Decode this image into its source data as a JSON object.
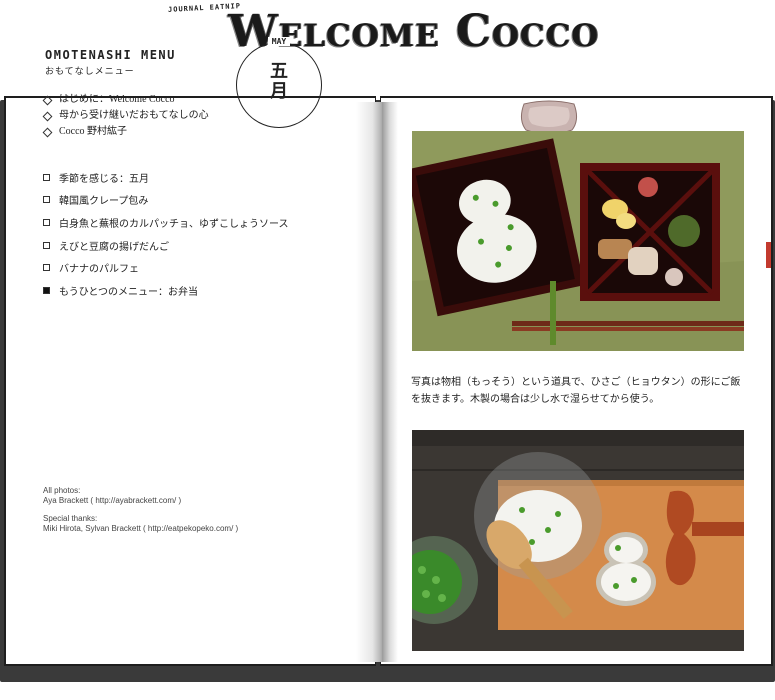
{
  "header": {
    "journal_label": "JOURNAL EATNIP",
    "title": "Welcome Cocco"
  },
  "left_page": {
    "menu_title": "OMOTENASHI MENU",
    "menu_subtitle": "おもてなしメニュー",
    "month": {
      "label_en": "MAY",
      "kanji_1": "五",
      "kanji_2": "月"
    },
    "intro_items": [
      {
        "label": "はじめに：Welcome Cocco"
      },
      {
        "label": "母から受け継いだおもてなしの心"
      },
      {
        "label": "Cocco 野村紘子"
      }
    ],
    "recipe_items": [
      {
        "label": "季節を感じる：五月",
        "selected": false
      },
      {
        "label": "韓国風クレープ包み",
        "selected": false
      },
      {
        "label": "白身魚と蕪根のカルパッチョ、ゆずこしょうソース",
        "selected": false
      },
      {
        "label": "えびと豆腐の揚げだんご",
        "selected": false
      },
      {
        "label": "バナナのパルフェ",
        "selected": false
      },
      {
        "label": "もうひとつのメニュー：お弁当",
        "selected": true
      }
    ],
    "credits": {
      "photos_label": "All photos:",
      "photos_value": "Aya Brackett ( http://ayabrackett.com/ )",
      "thanks_label": "Special thanks:",
      "thanks_value": "Miki Hirota, Sylvan Brackett ( http://eatpekopeko.com/ )"
    }
  },
  "right_page": {
    "caption_line1": "写真は物相（もっそう）という道具で、ひさご（ヒョウタン）の形にご飯",
    "caption_line2": "を抜きます。木製の場合は少し水で湿らせてから使う。"
  },
  "colors": {
    "ink": "#1e1e1e",
    "bookmark": "#c33a2e",
    "bento_red": "#6e1410",
    "tablecloth": "#8f9a5c",
    "cutting_board": "#d48a4a"
  }
}
